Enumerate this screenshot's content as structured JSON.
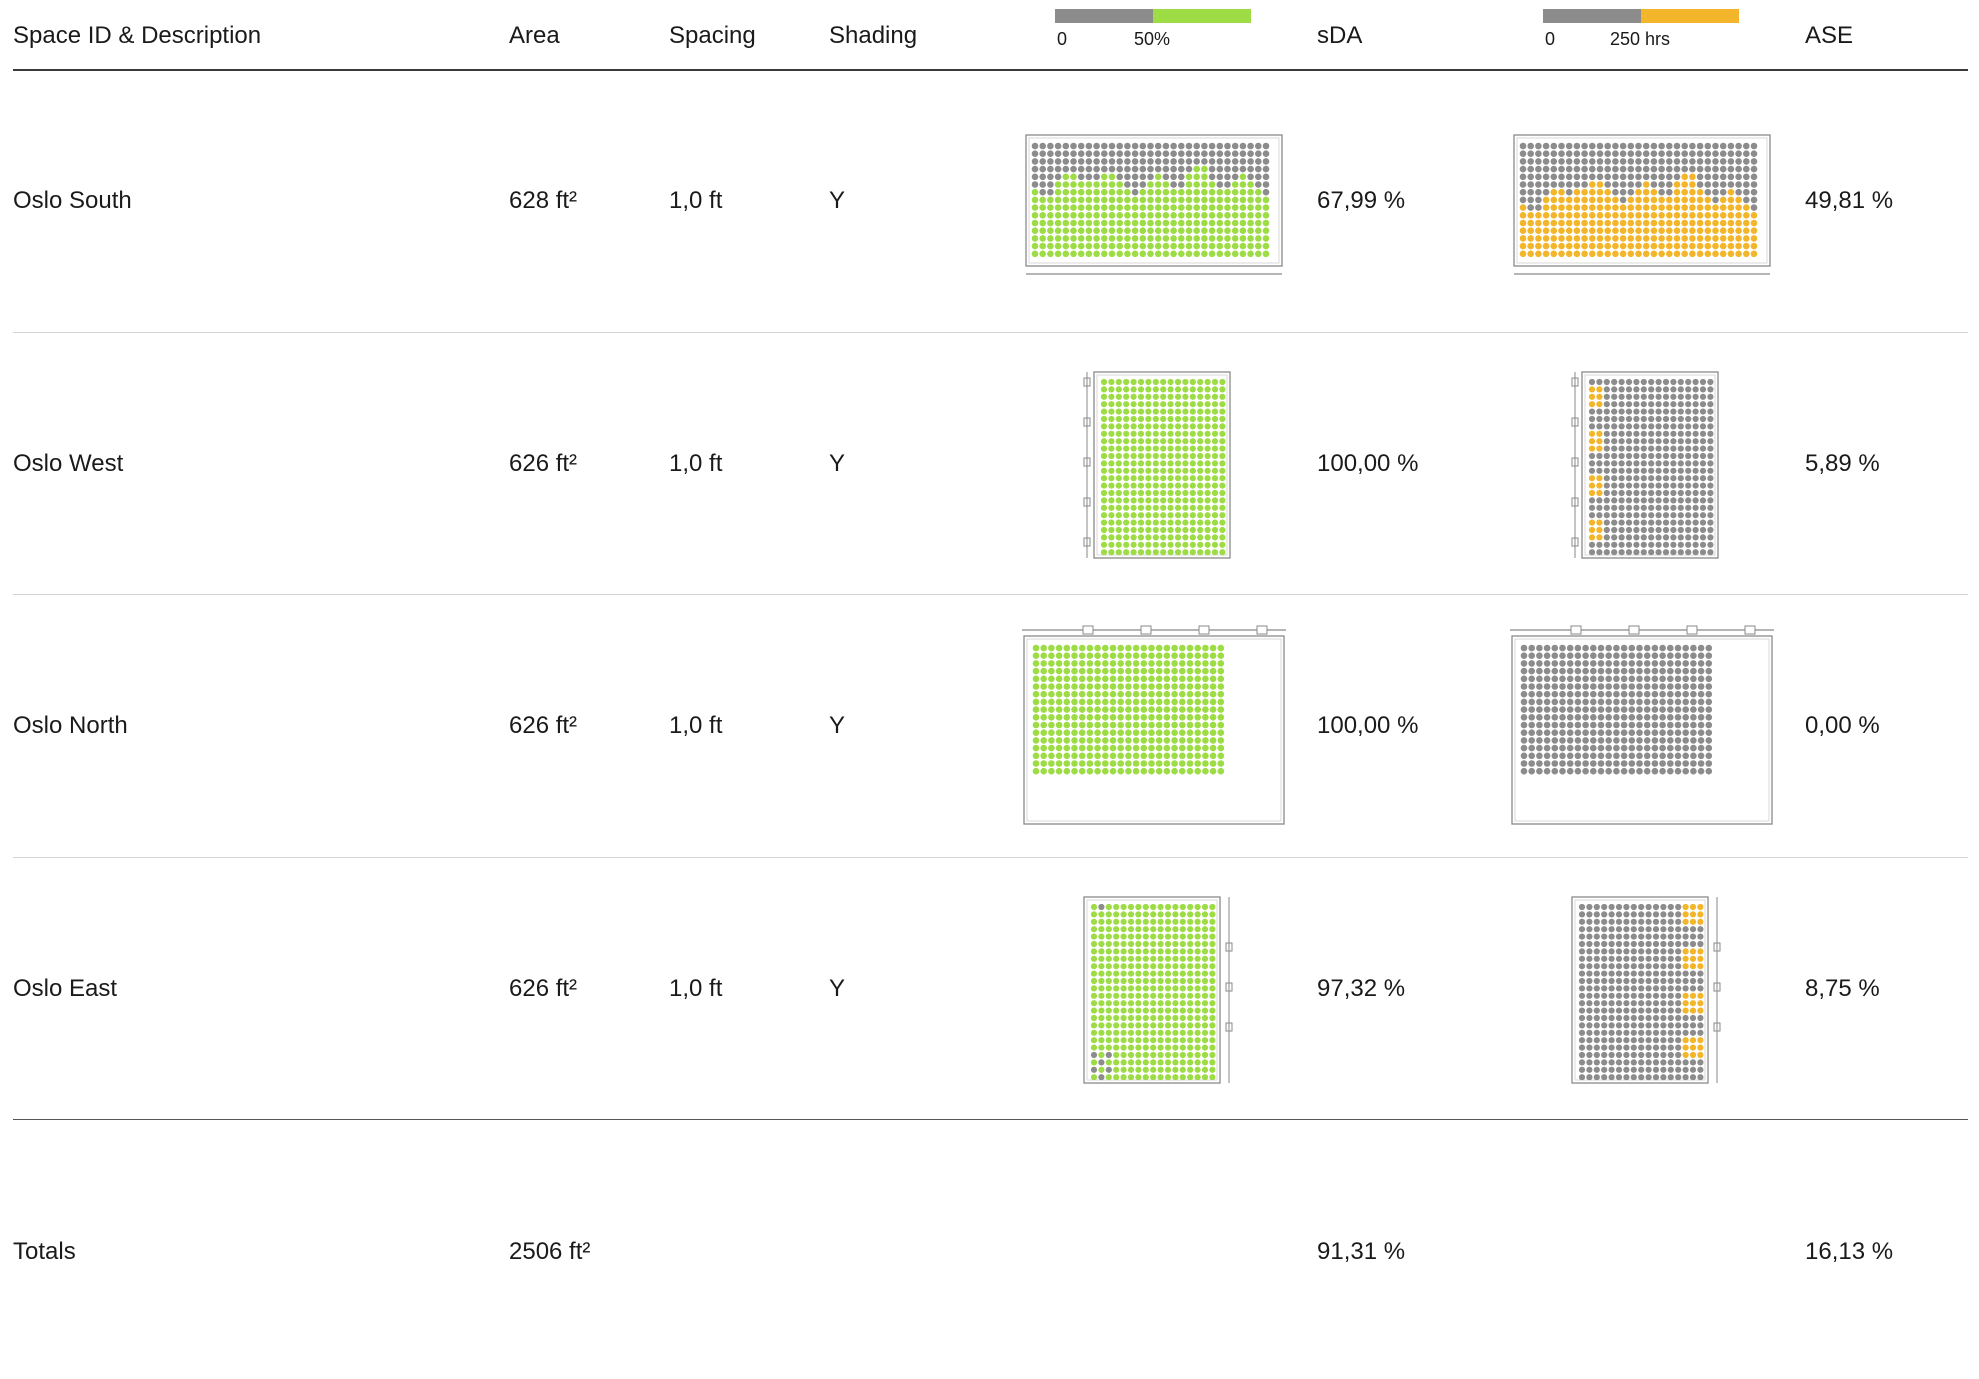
{
  "headers": {
    "space": "Space ID & Description",
    "area": "Area",
    "spacing": "Spacing",
    "shading": "Shading",
    "sda": "sDA",
    "ase": "ASE"
  },
  "legends": {
    "sda": {
      "min": "0",
      "mid": "50%",
      "low_color": "#8c8c8c",
      "high_color": "#9ddc44"
    },
    "ase": {
      "min": "0",
      "mid": "250 hrs",
      "low_color": "#8c8c8c",
      "high_color": "#f3b62a"
    }
  },
  "colors": {
    "base_dot": "#8c8c8c",
    "sda_dot": "#9ddc44",
    "ase_dot": "#f3b62a",
    "frame": "#8a8a8a"
  },
  "rows": [
    {
      "name": "Oslo South",
      "area": "628 ft²",
      "spacing": "1,0 ft",
      "shading": "Y",
      "sda": "67,99 %",
      "ase": "49,81 %",
      "orientation": "south"
    },
    {
      "name": "Oslo West",
      "area": "626 ft²",
      "spacing": "1,0 ft",
      "shading": "Y",
      "sda": "100,00 %",
      "ase": "5,89 %",
      "orientation": "west"
    },
    {
      "name": "Oslo North",
      "area": "626 ft²",
      "spacing": "1,0 ft",
      "shading": "Y",
      "sda": "100,00 %",
      "ase": "0,00 %",
      "orientation": "north"
    },
    {
      "name": "Oslo East",
      "area": "626 ft²",
      "spacing": "1,0 ft",
      "shading": "Y",
      "sda": "97,32 %",
      "ase": "8,75 %",
      "orientation": "east"
    }
  ],
  "totals": {
    "label": "Totals",
    "area": "2506 ft²",
    "sda": "91,31 %",
    "ase": "16,13 %"
  }
}
